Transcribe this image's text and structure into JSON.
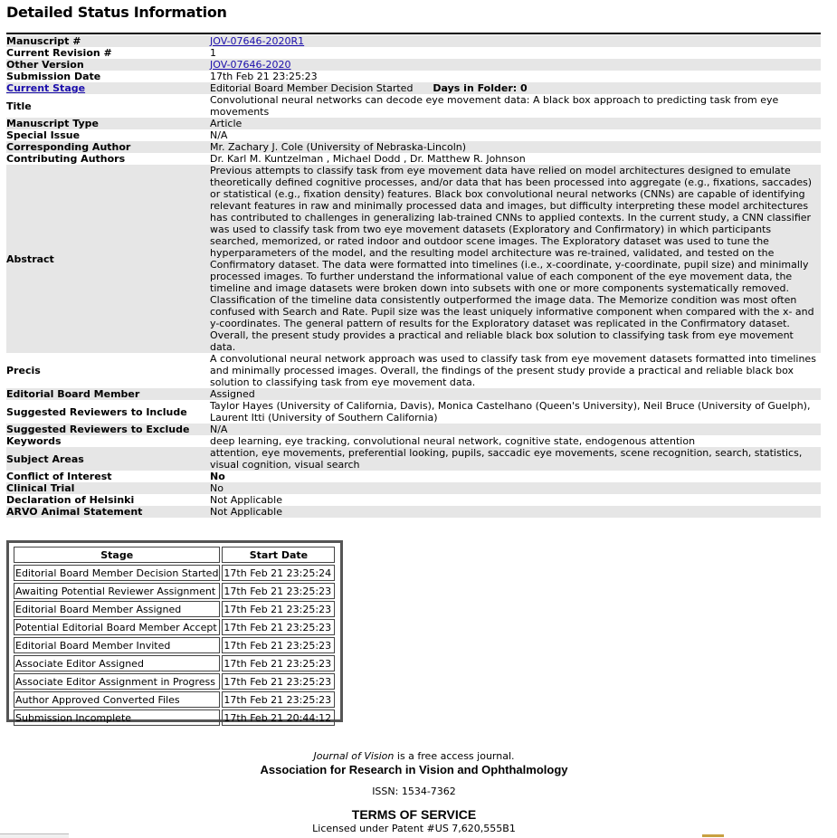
{
  "page_title": "Detailed Status Information",
  "details": [
    {
      "label": "Manuscript #",
      "value": "JOV-07646-2020R1",
      "link": true,
      "shade": true
    },
    {
      "label": "Current Revision #",
      "value": "1",
      "shade": false
    },
    {
      "label": "Other Version",
      "value": "JOV-07646-2020",
      "link": true,
      "shade": true
    },
    {
      "label": "Submission Date",
      "value": "17th Feb 21 23:25:23",
      "shade": false
    },
    {
      "label": "Current Stage",
      "label_link": true,
      "value": "Editorial Board Member Decision Started",
      "extra": "Days in Folder: 0",
      "shade": true
    },
    {
      "label": "Title",
      "value": "Convolutional neural networks can decode eye movement data: A black box approach to predicting task from eye movements",
      "shade": false
    },
    {
      "label": "Manuscript Type",
      "value": "Article",
      "shade": true
    },
    {
      "label": "Special Issue",
      "value": "N/A",
      "shade": false
    },
    {
      "label": "Corresponding Author",
      "value": "Mr. Zachary J. Cole (University of Nebraska-Lincoln)",
      "shade": true
    },
    {
      "label": "Contributing Authors",
      "value": "Dr. Karl M. Kuntzelman , Michael Dodd , Dr. Matthew R. Johnson",
      "shade": false
    },
    {
      "label": "Abstract",
      "value": "Previous attempts to classify task from eye movement data have relied on model architectures designed to emulate theoretically defined cognitive processes, and/or data that has been processed into aggregate (e.g., fixations, saccades) or statistical (e.g., fixation density) features. Black box convolutional neural networks (CNNs) are capable of identifying relevant features in raw and minimally processed data and images, but difficulty interpreting these model architectures has contributed to challenges in generalizing lab-trained CNNs to applied contexts. In the current study, a CNN classifier was used to classify task from two eye movement datasets (Exploratory and Confirmatory) in which participants searched, memorized, or rated indoor and outdoor scene images. The Exploratory dataset was used to tune the hyperparameters of the model, and the resulting model architecture was re-trained, validated, and tested on the Confirmatory dataset. The data were formatted into timelines (i.e., x-coordinate, y-coordinate, pupil size) and minimally processed images. To further understand the informational value of each component of the eye movement data, the timeline and image datasets were broken down into subsets with one or more components systematically removed. Classification of the timeline data consistently outperformed the image data. The Memorize condition was most often confused with Search and Rate. Pupil size was the least uniquely informative component when compared with the x- and y-coordinates. The general pattern of results for the Exploratory dataset was replicated in the Confirmatory dataset. Overall, the present study provides a practical and reliable black box solution to classifying task from eye movement data.",
      "shade": true
    },
    {
      "label": "Precis",
      "value": "A convolutional neural network approach was used to classify task from eye movement datasets formatted into timelines and minimally processed images. Overall, the findings of the present study provide a practical and reliable black box solution to classifying task from eye movement data.",
      "shade": false
    },
    {
      "label": "Editorial Board Member",
      "value": "Assigned",
      "shade": true
    },
    {
      "label": "Suggested Reviewers to Include",
      "value": "Taylor Hayes (University of California, Davis), Monica Castelhano (Queen's University), Neil Bruce (University of Guelph), Laurent Itti (University of Southern California)",
      "shade": false
    },
    {
      "label": "Suggested Reviewers to Exclude",
      "value": "N/A",
      "shade": true
    },
    {
      "label": "Keywords",
      "value": "deep learning, eye tracking, convolutional neural network, cognitive state, endogenous attention",
      "shade": false
    },
    {
      "label": "Subject Areas",
      "value": "attention, eye movements, preferential looking, pupils, saccadic eye movements, scene recognition, search, statistics, visual cognition, visual search",
      "shade": true
    },
    {
      "label": "Conflict of Interest",
      "value": "No",
      "bold_value": true,
      "shade": false
    },
    {
      "label": "Clinical Trial",
      "value": "No",
      "shade": true
    },
    {
      "label": "Declaration of Helsinki",
      "value": "Not Applicable",
      "shade": false
    },
    {
      "label": "ARVO Animal Statement",
      "value": "Not Applicable",
      "shade": true
    }
  ],
  "stage_table": {
    "headers": [
      "Stage",
      "Start Date"
    ],
    "rows": [
      [
        "Editorial Board Member Decision Started",
        "17th Feb 21 23:25:24"
      ],
      [
        "Awaiting Potential Reviewer Assignment",
        "17th Feb 21 23:25:23"
      ],
      [
        "Editorial Board Member Assigned",
        "17th Feb 21 23:25:23"
      ],
      [
        "Potential Editorial Board Member Accept",
        "17th Feb 21 23:25:23"
      ],
      [
        "Editorial Board Member Invited",
        "17th Feb 21 23:25:23"
      ],
      [
        "Associate Editor Assigned",
        "17th Feb 21 23:25:23"
      ],
      [
        "Associate Editor Assignment in Progress",
        "17th Feb 21 23:25:23"
      ],
      [
        "Author Approved Converted Files",
        "17th Feb 21 23:25:23"
      ],
      [
        "Submission Incomplete",
        "17th Feb 21 20:44:12"
      ]
    ]
  },
  "footer": {
    "journal_name": "Journal of Vision",
    "journal_suffix": " is a free access journal.",
    "association": "Association for Research in Vision and Ophthalmology",
    "issn": "ISSN: 1534-7362",
    "terms": "TERMS OF SERVICE",
    "license": "Licensed under Patent #US 7,620,555B1"
  }
}
